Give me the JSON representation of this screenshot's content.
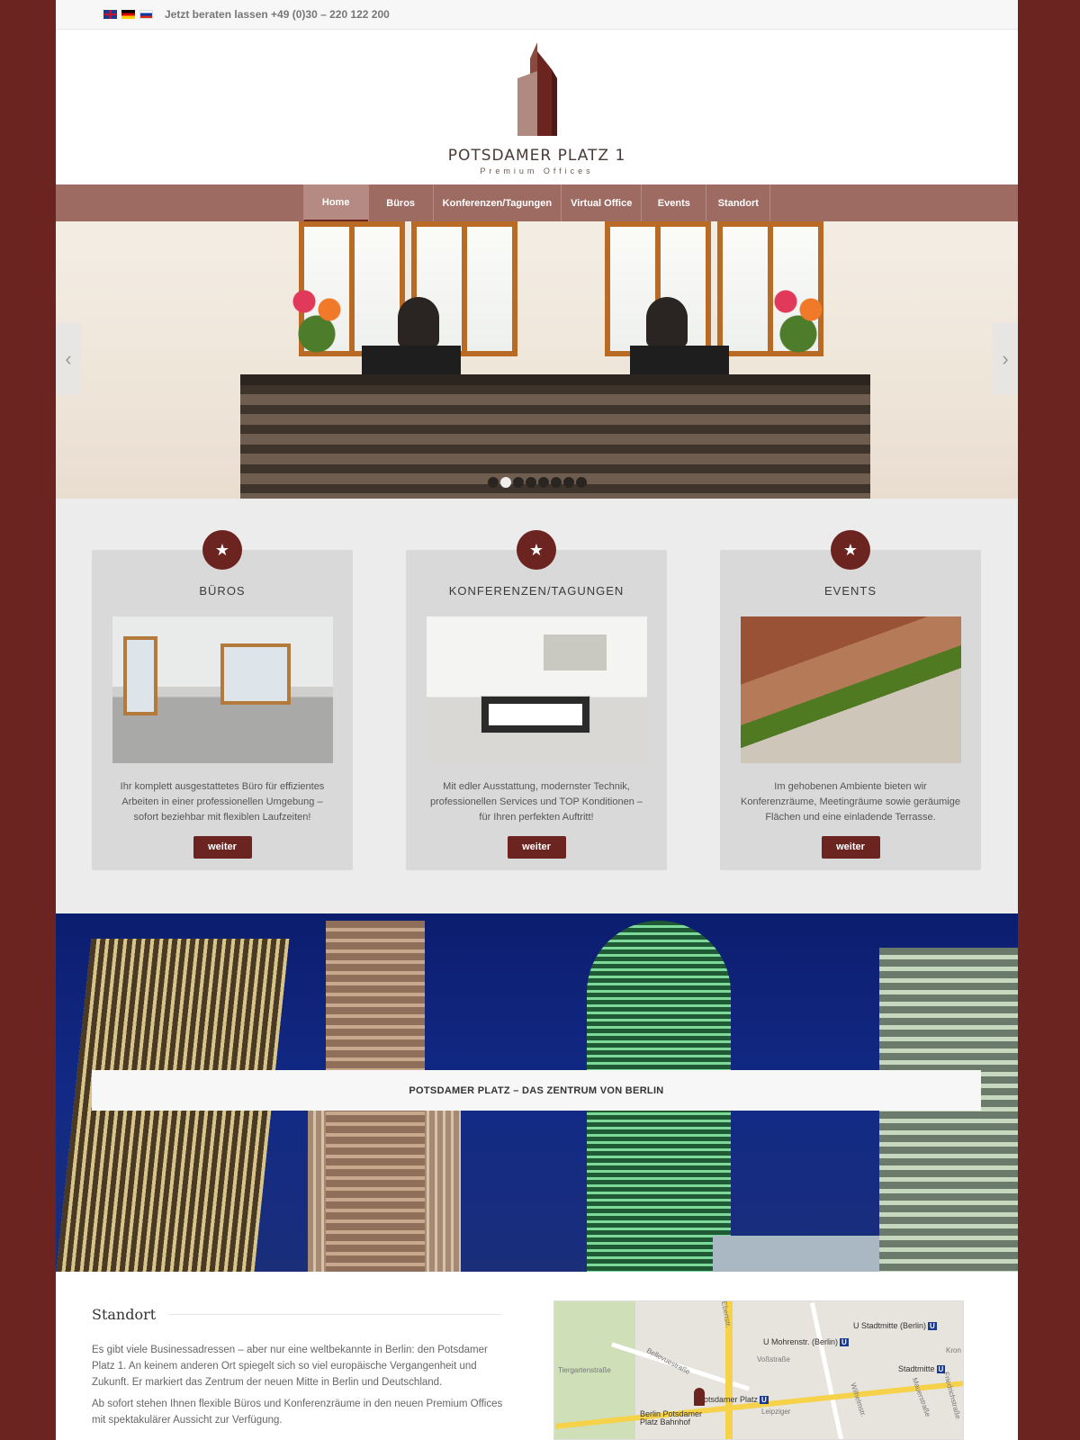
{
  "topbar": {
    "flags": [
      "flag-en",
      "flag-de",
      "flag-ru"
    ],
    "contact": "Jetzt beraten lassen +49 (0)30 – 220 122 200"
  },
  "logo": {
    "title": "POTSDAMER PLATZ 1",
    "subtitle": "Premium Offices"
  },
  "nav": {
    "items": [
      {
        "label": "Home",
        "active": true
      },
      {
        "label": "Büros"
      },
      {
        "label": "Konferenzen/Tagungen"
      },
      {
        "label": "Virtual Office"
      },
      {
        "label": "Events"
      },
      {
        "label": "Standort"
      }
    ]
  },
  "slider": {
    "prev_icon": "chevron-left-icon",
    "next_icon": "chevron-right-icon",
    "slide_count": 8,
    "active_slide": 2
  },
  "features": [
    {
      "icon": "star-icon",
      "title": "BÜROS",
      "text": "Ihr komplett ausgestattetes Büro für effizientes Arbeiten in einer professionellen Umgebung – sofort beziehbar mit flexiblen Laufzeiten!",
      "button": "weiter"
    },
    {
      "icon": "star-icon",
      "title": "KONFERENZEN/TAGUNGEN",
      "text": "Mit edler Ausstattung, modernster Technik, professionellen Services und TOP Konditionen – für Ihren perfekten Auftritt!",
      "button": "weiter"
    },
    {
      "icon": "star-icon",
      "title": "EVENTS",
      "text": "Im gehobenen Ambiente bieten wir Konferenzräume, Meetingräume sowie geräumige Flächen und eine einladende Terrasse.",
      "button": "weiter"
    }
  ],
  "banner": {
    "caption": "POTSDAMER PLATZ – DAS ZENTRUM VON BERLIN"
  },
  "standort": {
    "title": "Standort",
    "p1": "Es gibt viele Businessadressen – aber nur eine weltbekannte in Berlin: den Potsdamer Platz 1. An keinem anderen Ort spiegelt sich so viel europäische Vergangenheit und Zukunft. Er markiert das Zentrum der neuen Mitte in Berlin und Deutschland.",
    "p2": "Ab sofort stehen Ihnen flexible Büros und Konferenzräume in den neuen Premium Offices mit spektakulärer Aussicht zur Verfügung."
  },
  "map": {
    "stations": [
      "U Stadtmitte (Berlin)",
      "U Mohrenstr. (Berlin)",
      "Stadtmitte",
      "Potsdamer Platz",
      "Berlin Potsdamer Platz Bahnhof"
    ],
    "streets": [
      "Tiergartenstraße",
      "Bellevuestraße",
      "Voßstraße",
      "Ebertstr.",
      "Leipziger",
      "Wilhelmstr.",
      "Mauerstraße",
      "Friedrichstraße",
      "Kron"
    ],
    "u_badge": "U"
  },
  "colors": {
    "brand": "#6b2420",
    "nav": "#9e6b63"
  }
}
